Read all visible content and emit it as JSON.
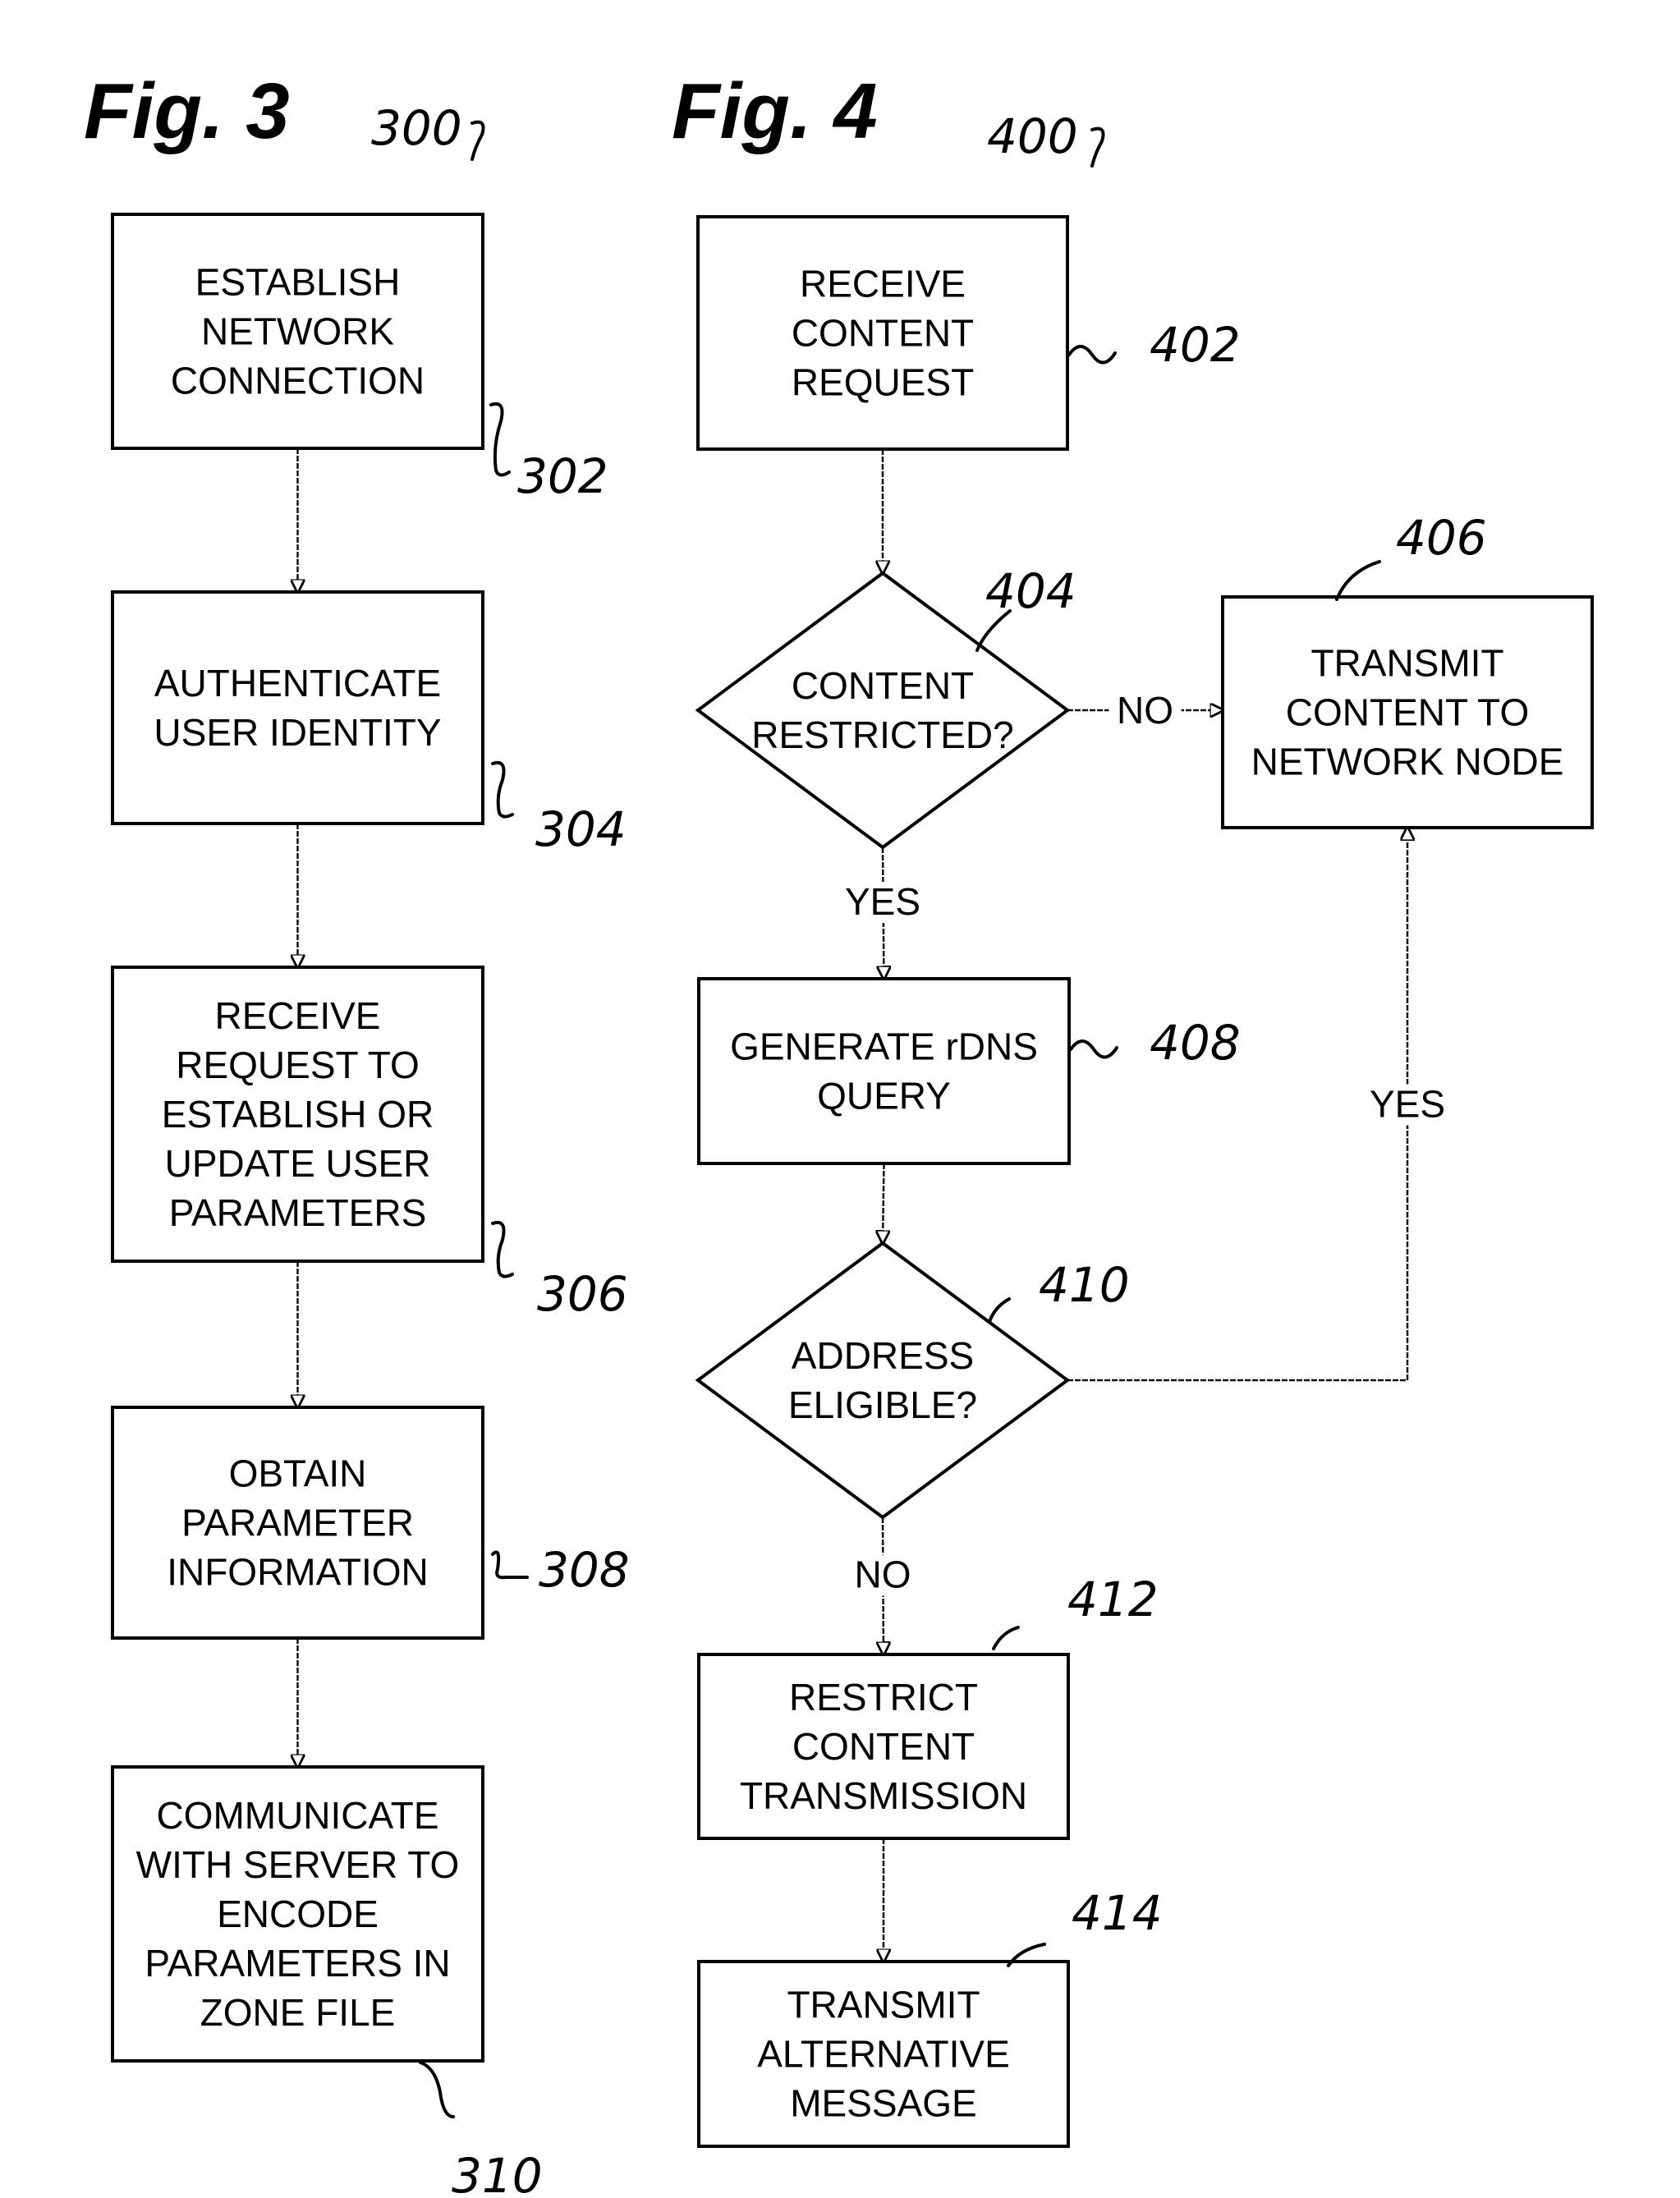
{
  "figures": [
    {
      "id": "fig3",
      "title": "Fig. 3",
      "ref": "300",
      "nodes": [
        {
          "id": "302",
          "type": "process",
          "ref": "302",
          "lines": [
            "ESTABLISH",
            "NETWORK",
            "CONNECTION"
          ]
        },
        {
          "id": "304",
          "type": "process",
          "ref": "304",
          "lines": [
            "AUTHENTICATE",
            "USER IDENTITY"
          ]
        },
        {
          "id": "306",
          "type": "process",
          "ref": "306",
          "lines": [
            "RECEIVE",
            "REQUEST TO",
            "ESTABLISH OR",
            "UPDATE USER",
            "PARAMETERS"
          ]
        },
        {
          "id": "308",
          "type": "process",
          "ref": "308",
          "lines": [
            "OBTAIN",
            "PARAMETER",
            "INFORMATION"
          ]
        },
        {
          "id": "310",
          "type": "process",
          "ref": "310",
          "lines": [
            "COMMUNICATE",
            "WITH SERVER TO",
            "ENCODE",
            "PARAMETERS IN",
            "ZONE FILE"
          ]
        }
      ],
      "edges": [
        {
          "from": "302",
          "to": "304",
          "label": ""
        },
        {
          "from": "304",
          "to": "306",
          "label": ""
        },
        {
          "from": "306",
          "to": "308",
          "label": ""
        },
        {
          "from": "308",
          "to": "310",
          "label": ""
        }
      ]
    },
    {
      "id": "fig4",
      "title": "Fig. 4",
      "ref": "400",
      "nodes": [
        {
          "id": "402",
          "type": "process",
          "ref": "402",
          "lines": [
            "RECEIVE",
            "CONTENT",
            "REQUEST"
          ]
        },
        {
          "id": "404",
          "type": "decision",
          "ref": "404",
          "lines": [
            "CONTENT",
            "RESTRICTED?"
          ]
        },
        {
          "id": "406",
          "type": "process",
          "ref": "406",
          "lines": [
            "TRANSMIT",
            "CONTENT TO",
            "NETWORK NODE"
          ]
        },
        {
          "id": "408",
          "type": "process",
          "ref": "408",
          "lines": [
            "GENERATE rDNS",
            "QUERY"
          ]
        },
        {
          "id": "410",
          "type": "decision",
          "ref": "410",
          "lines": [
            "ADDRESS",
            "ELIGIBLE?"
          ]
        },
        {
          "id": "412",
          "type": "process",
          "ref": "412",
          "lines": [
            "RESTRICT",
            "CONTENT",
            "TRANSMISSION"
          ]
        },
        {
          "id": "414",
          "type": "process",
          "ref": "414",
          "lines": [
            "TRANSMIT",
            "ALTERNATIVE",
            "MESSAGE"
          ]
        }
      ],
      "edges": [
        {
          "from": "402",
          "to": "404",
          "label": ""
        },
        {
          "from": "404",
          "to": "406",
          "label": "NO"
        },
        {
          "from": "404",
          "to": "408",
          "label": "YES"
        },
        {
          "from": "408",
          "to": "410",
          "label": ""
        },
        {
          "from": "410",
          "to": "406",
          "label": "YES"
        },
        {
          "from": "410",
          "to": "412",
          "label": "NO"
        },
        {
          "from": "412",
          "to": "414",
          "label": ""
        }
      ]
    }
  ]
}
